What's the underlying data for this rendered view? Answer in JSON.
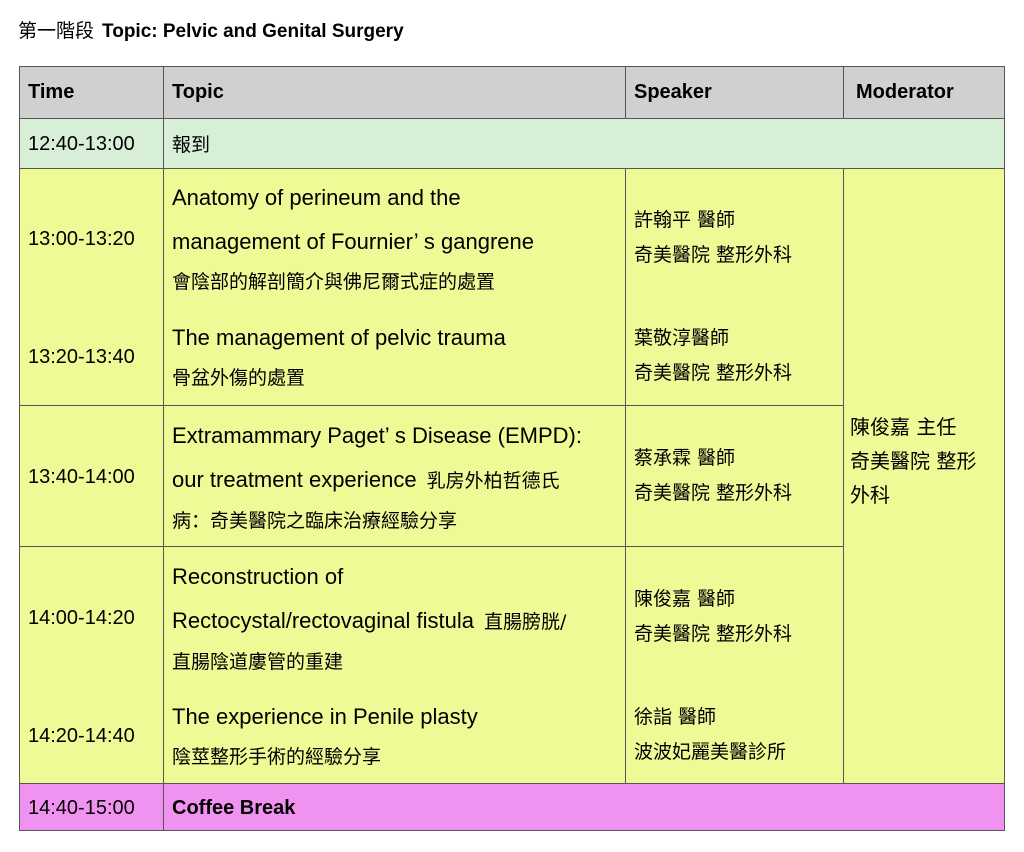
{
  "heading": {
    "stage": "第一階段",
    "topic": "Topic: Pelvic and Genital Surgery"
  },
  "columns": {
    "time": "Time",
    "topic": "Topic",
    "speaker": "Speaker",
    "moderator": "Moderator"
  },
  "registration": {
    "time": "12:40-13:00",
    "label": "報到"
  },
  "sessions": [
    {
      "time": "13:00-13:20",
      "topic_en_1": "Anatomy of perineum and the",
      "topic_en_2": "management of Fournier’ s gangrene",
      "topic_cn": "會陰部的解剖簡介與佛尼爾式症的處置",
      "speaker_name": "許翰平 醫師",
      "speaker_org": "奇美醫院 整形外科"
    },
    {
      "time": "13:20-13:40",
      "topic_en_1": "The management of pelvic trauma",
      "topic_cn": "骨盆外傷的處置",
      "speaker_name": "葉敬淳醫師",
      "speaker_org": "奇美醫院 整形外科"
    },
    {
      "time": "13:40-14:00",
      "topic_en_1": "Extramammary Paget’ s Disease (EMPD):",
      "topic_en_2": "our treatment experience",
      "topic_cn_inline": "乳房外柏哲德氏",
      "topic_cn": "病：奇美醫院之臨床治療經驗分享",
      "speaker_name": "蔡承霖 醫師",
      "speaker_org": "奇美醫院 整形外科"
    },
    {
      "time": "14:00-14:20",
      "topic_en_1": "Reconstruction of",
      "topic_en_2": "Rectocystal/rectovaginal fistula",
      "topic_cn_inline": "直腸膀胱/",
      "topic_cn": "直腸陰道廔管的重建",
      "speaker_name": "陳俊嘉 醫師",
      "speaker_org": "奇美醫院 整形外科"
    },
    {
      "time": "14:20-14:40",
      "topic_en_1": "The experience in Penile plasty",
      "topic_cn": "陰莖整形手術的經驗分享",
      "speaker_name": "徐詣 醫師",
      "speaker_org": "波波妃麗美醫診所"
    }
  ],
  "moderator": {
    "name": "陳俊嘉 主任",
    "org_1": "奇美醫院 整形",
    "org_2": "外科"
  },
  "coffee": {
    "time": "14:40-15:00",
    "label": "Coffee Break"
  },
  "colors": {
    "header": "#d0d0d0",
    "registration": "#d7eed7",
    "session": "#eefa96",
    "coffee": "#f093f0"
  }
}
